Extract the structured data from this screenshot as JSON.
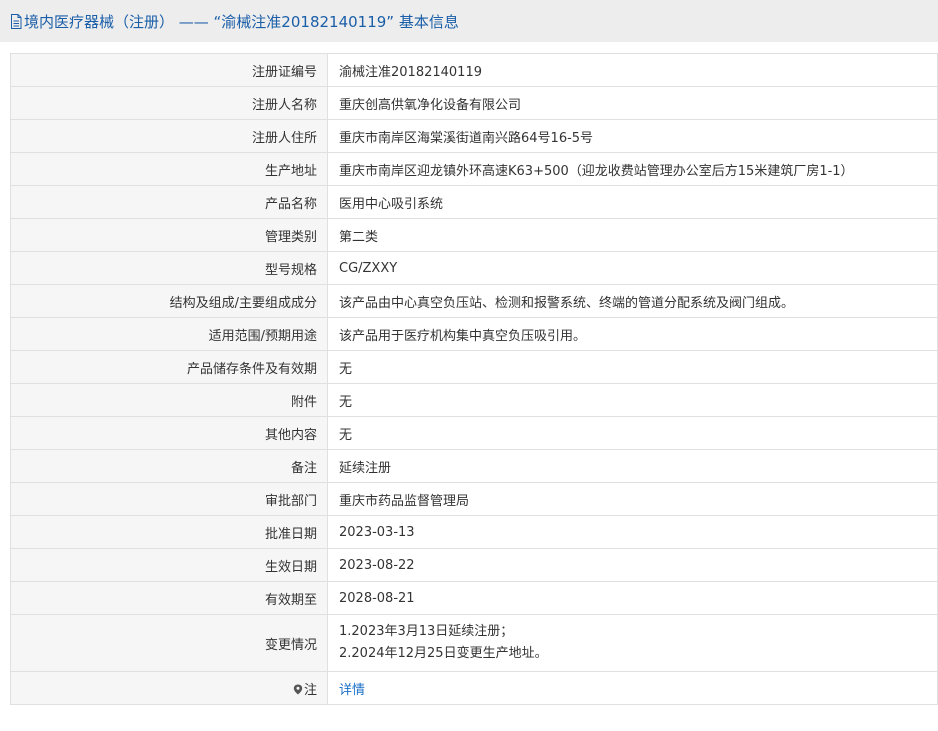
{
  "header": {
    "icon": "document-icon",
    "title": "境内医疗器械（注册） —— “渝械注准20182140119” 基本信息"
  },
  "rows": [
    {
      "label": "注册证编号",
      "value": "渝械注准20182140119"
    },
    {
      "label": "注册人名称",
      "value": "重庆创高供氧净化设备有限公司"
    },
    {
      "label": "注册人住所",
      "value": "重庆市南岸区海棠溪街道南兴路64号16-5号"
    },
    {
      "label": "生产地址",
      "value": "重庆市南岸区迎龙镇外环高速K63+500（迎龙收费站管理办公室后方15米建筑厂房1-1）"
    },
    {
      "label": "产品名称",
      "value": "医用中心吸引系统"
    },
    {
      "label": "管理类别",
      "value": "第二类"
    },
    {
      "label": "型号规格",
      "value": "CG/ZXXY"
    },
    {
      "label": "结构及组成/主要组成成分",
      "value": "该产品由中心真空负压站、检测和报警系统、终端的管道分配系统及阀门组成。"
    },
    {
      "label": "适用范围/预期用途",
      "value": "该产品用于医疗机构集中真空负压吸引用。"
    },
    {
      "label": "产品储存条件及有效期",
      "value": "无"
    },
    {
      "label": "附件",
      "value": "无"
    },
    {
      "label": "其他内容",
      "value": "无"
    },
    {
      "label": "备注",
      "value": "延续注册"
    },
    {
      "label": "审批部门",
      "value": "重庆市药品监督管理局"
    },
    {
      "label": "批准日期",
      "value": "2023-03-13"
    },
    {
      "label": "生效日期",
      "value": "2023-08-22"
    },
    {
      "label": "有效期至",
      "value": "2028-08-21"
    }
  ],
  "changes": {
    "label": "变更情况",
    "lines": [
      "1.2023年3月13日延续注册；",
      "2.2024年12月25日变更生产地址。"
    ]
  },
  "note": {
    "icon": "pin-icon",
    "label": "注",
    "link_text": "详情"
  },
  "colors": {
    "header_bg": "#ededed",
    "title": "#1a5ea8",
    "label_bg": "#f6f6f6",
    "border": "#e0e0e0",
    "link": "#1a6fc7"
  }
}
